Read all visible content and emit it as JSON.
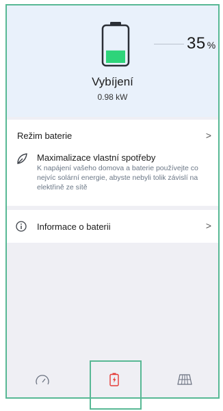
{
  "battery": {
    "percent": "35",
    "percent_unit": "%",
    "level_fraction": 0.35,
    "state_label": "Vybíjení",
    "power": "0.98 kW",
    "fill_color": "#2ed47a"
  },
  "mode_card": {
    "title": "Režim baterie",
    "chevron": ">",
    "mode_name": "Maximalizace vlastní spotřeby",
    "mode_description": "K napájení vašeho domova a baterie používejte co nejvíc solární energie, abyste nebyli tolik závislí na elektřině ze sítě",
    "icon": "leaf-icon"
  },
  "info_card": {
    "label": "Informace o baterii",
    "chevron": ">",
    "icon": "info-icon"
  },
  "nav": {
    "items": [
      {
        "icon": "speedometer-icon",
        "active": false
      },
      {
        "icon": "battery-icon",
        "active": true
      },
      {
        "icon": "solar-panel-icon",
        "active": false
      }
    ],
    "active_color": "#e53935",
    "highlight_color": "#57b894"
  }
}
